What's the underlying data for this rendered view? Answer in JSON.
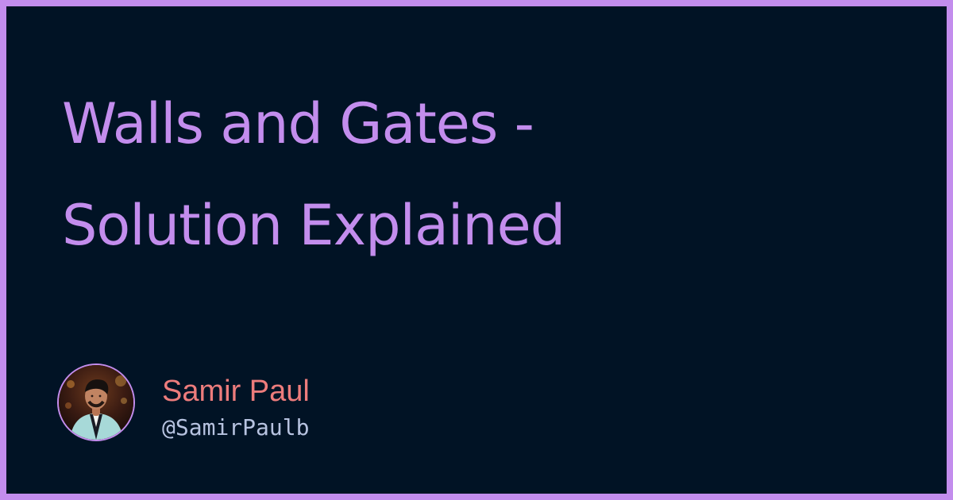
{
  "title": {
    "line1": "Walls and Gates -",
    "line2": "Solution Explained"
  },
  "author": {
    "name": "Samir Paul",
    "handle": "@SamirPaulb",
    "avatar_icon": "person-avatar"
  },
  "colors": {
    "background": "#011325",
    "border": "#c38ded",
    "title": "#c38ded",
    "author_name": "#ed7c7c",
    "author_handle": "#b7c3e0"
  }
}
